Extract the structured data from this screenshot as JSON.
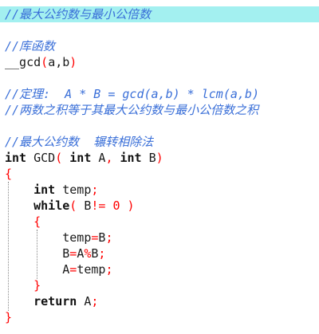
{
  "lines": {
    "l1": "//最大公约数与最小公倍数",
    "l3": "//库函数",
    "l4_fn": "__gcd",
    "l4_open": "(",
    "l4_args": "a,b",
    "l4_close": ")",
    "l6": "//定理:  A * B = gcd(a,b) * lcm(a,b)",
    "l7": "//两数之积等于其最大公约数与最小公倍数之积",
    "l9": "//最大公约数  辗转相除法",
    "l10_int1": "int",
    "l10_name": " GCD",
    "l10_paren": "(",
    "l10_int2": " int",
    "l10_a": " A",
    "l10_comma": ",",
    "l10_int3": " int",
    "l10_b": " B",
    "l10_close": ")",
    "l11_brace": "{",
    "l12_int": "int",
    "l12_rest": " temp",
    "l12_semi": ";",
    "l13_while": "while",
    "l13_paren": "(",
    "l13_b": " B",
    "l13_ne": "!=",
    "l13_zero": " 0 ",
    "l13_close": ")",
    "l14_brace": "{",
    "l15_var": "temp",
    "l15_eq": "=",
    "l15_b": "B",
    "l15_semi": ";",
    "l16_b": "B",
    "l16_eq": "=",
    "l16_a": "A",
    "l16_mod": "%",
    "l16_b2": "B",
    "l16_semi": ";",
    "l17_a": "A",
    "l17_eq": "=",
    "l17_temp": "temp",
    "l17_semi": ";",
    "l18_brace": "}",
    "l19_ret": "return",
    "l19_a": " A",
    "l19_semi": ";",
    "l20_brace": "}"
  },
  "colors": {
    "comment": "#3a6fd8",
    "operator": "#ff0000",
    "highlight": "#a3f0f0"
  }
}
